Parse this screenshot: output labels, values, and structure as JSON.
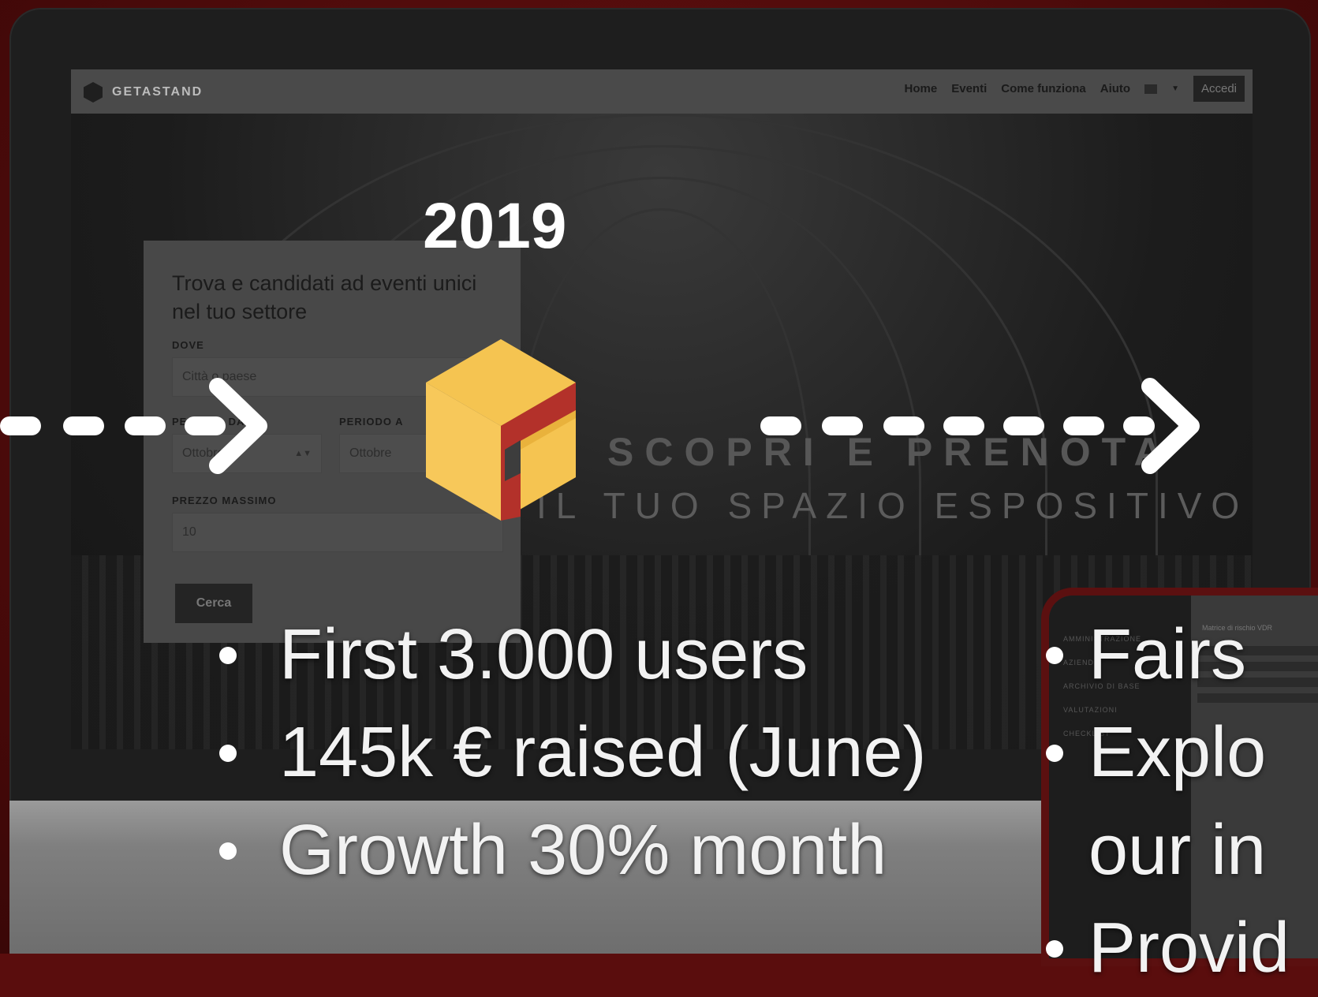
{
  "navbar": {
    "brand": "GETASTAND",
    "links": [
      "Home",
      "Eventi",
      "Come funziona",
      "Aiuto"
    ],
    "login": "Accedi"
  },
  "hero": {
    "title": "SCOPRI E PRENOTA",
    "subtitle": "IL TUO SPAZIO ESPOSITIVO"
  },
  "search_card": {
    "title": "Trova e candidati ad eventi unici nel tuo settore",
    "where_label": "DOVE",
    "where_placeholder": "Città o paese",
    "from_label": "PERIODO DA",
    "from_value": "Ottobre",
    "to_label": "PERIODO A",
    "to_value": "Ottobre",
    "price_label": "PREZZO MASSIMO",
    "price_value": "10",
    "search_button": "Cerca"
  },
  "overlay": {
    "year": "2019",
    "bullets": [
      "First 3.000 users",
      "145k € raised (June)",
      "Growth 30% month"
    ]
  },
  "tablet": {
    "sidebar_items": [
      "AMMINISTRAZIONE",
      "AZIENDE",
      "ARCHIVIO DI BASE",
      "VALUTAZIONI",
      "CHECKLIST"
    ],
    "header": "Matrice di rischio VDR",
    "text_lines": [
      "Fairs",
      "Explo",
      "our in",
      "Provid"
    ]
  },
  "colors": {
    "background": "#5a0d0d",
    "logo_yellow": "#f5c451",
    "logo_red": "#b3312a"
  }
}
